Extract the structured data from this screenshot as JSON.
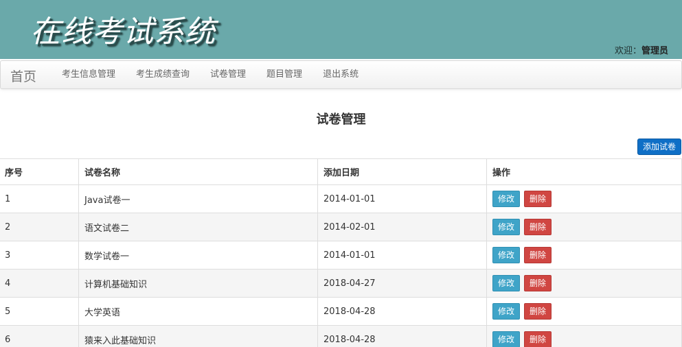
{
  "header": {
    "title": "在线考试系统",
    "welcome_prefix": "欢迎：",
    "welcome_user": "管理员"
  },
  "nav": {
    "brand": "首页",
    "items": [
      {
        "label": "考生信息管理"
      },
      {
        "label": "考生成绩查询"
      },
      {
        "label": "试卷管理"
      },
      {
        "label": "题目管理"
      },
      {
        "label": "退出系统"
      }
    ]
  },
  "main": {
    "heading": "试卷管理",
    "add_button": "添加试卷",
    "columns": [
      "序号",
      "试卷名称",
      "添加日期",
      "操作"
    ],
    "rows": [
      {
        "id": "1",
        "name": "Java试卷一",
        "date": "2014-01-01"
      },
      {
        "id": "2",
        "name": "语文试卷二",
        "date": "2014-02-01"
      },
      {
        "id": "3",
        "name": "数学试卷一",
        "date": "2014-01-01"
      },
      {
        "id": "4",
        "name": "计算机基础知识",
        "date": "2018-04-27"
      },
      {
        "id": "5",
        "name": "大学英语",
        "date": "2018-04-28"
      },
      {
        "id": "6",
        "name": "猿来入此基础知识",
        "date": "2018-04-28"
      }
    ],
    "edit_label": "修改",
    "delete_label": "删除"
  }
}
